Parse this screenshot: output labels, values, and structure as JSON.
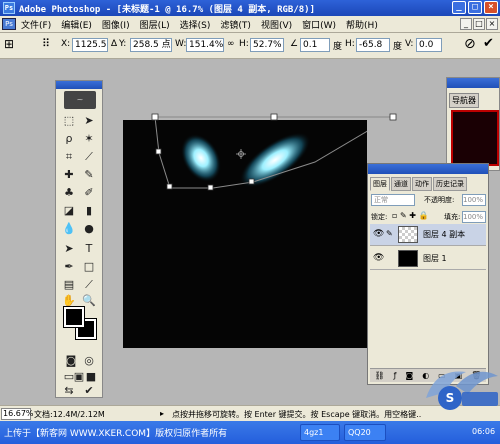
{
  "title_bar": {
    "title": "Adobe Photoshop - [未标题-1 @ 16.7% (图层 4 副本, RGB/8)]",
    "minimize": "_",
    "maximize": "□",
    "close": "×"
  },
  "menu": {
    "items": [
      "文件(F)",
      "编辑(E)",
      "图像(I)",
      "图层(L)",
      "选择(S)",
      "滤镜(T)",
      "视图(V)",
      "窗口(W)",
      "帮助(H)"
    ],
    "window_buttons": [
      "_",
      "□",
      "×"
    ]
  },
  "options": {
    "x_label": "X:",
    "x_value": "1125.5",
    "y_label": "Y:",
    "y_value": "258.5 点",
    "w_label": "W:",
    "w_value": "151.4%",
    "h_label": "H:",
    "h_value": "52.7%",
    "angle_value": "0.1",
    "angle_unit": "度",
    "hskew_label": "H:",
    "hskew_value": "-65.8",
    "hskew_unit": "度",
    "vskew_label": "V:",
    "vskew_value": "0.0",
    "cancel_icon": "⊘",
    "commit_icon": "✔"
  },
  "navigator": {
    "tab_label": "导航器"
  },
  "layers_panel": {
    "tabs": [
      "图层",
      "通道",
      "动作",
      "历史记录"
    ],
    "blend_mode": "正常",
    "opacity_label": "不透明度:",
    "opacity_value": "100%",
    "lock_label": "锁定:",
    "fill_label": "填充:",
    "fill_value": "100%",
    "layers": [
      {
        "name": "图层 4 副本",
        "selected": true,
        "thumb": "transparent"
      },
      {
        "name": "图层 1",
        "selected": false,
        "thumb": "black"
      }
    ]
  },
  "status": {
    "zoom": "16.67%",
    "doc_info": "文档:12.4M/2.12M",
    "hint": "点按并拖移可旋转。按 Enter 键提交。按 Escape 键取消。用空格键..."
  },
  "taskbar": {
    "start_text": "上传于【新客网 WWW.XKER.COM】版权归原作者所有",
    "tasks": [
      "4gz1",
      "QQ20"
    ],
    "clock": "06:06"
  },
  "colors": {
    "title_blue": "#1b47b8",
    "chrome": "#ece9d8",
    "workspace": "#b6b6b6",
    "glow": "#7fe6ff"
  }
}
